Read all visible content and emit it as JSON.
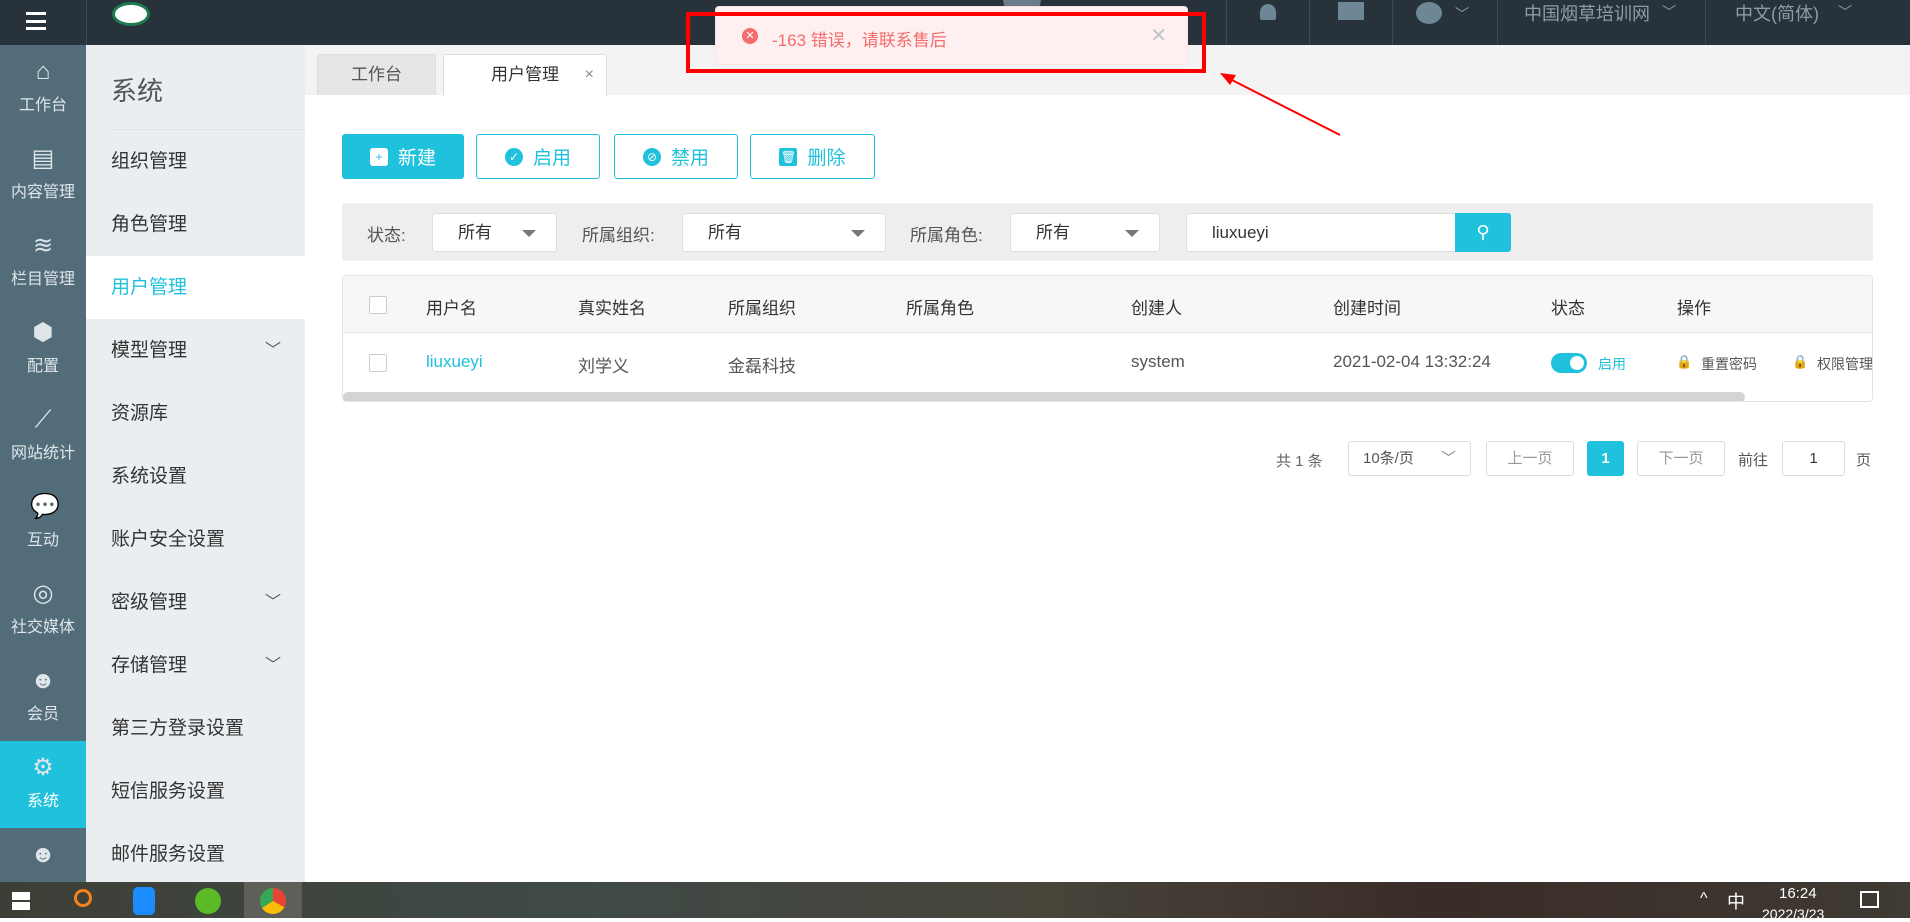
{
  "header": {
    "language": "中文(简体)",
    "site": "中国烟草培训网",
    "icons": [
      "menu-icon",
      "logo",
      "bell-icon",
      "monitor-icon",
      "palette-icon"
    ]
  },
  "toast": {
    "message": "-163 错误，请联系售后",
    "type": "error",
    "color": "#f56c6c"
  },
  "rail": [
    {
      "label": "工作台",
      "icon": "⌂"
    },
    {
      "label": "内容管理",
      "icon": "▤"
    },
    {
      "label": "栏目管理",
      "icon": "≋"
    },
    {
      "label": "配置",
      "icon": "⬢"
    },
    {
      "label": "网站统计",
      "icon": "⟋"
    },
    {
      "label": "互动",
      "icon": "💬"
    },
    {
      "label": "社交媒体",
      "icon": "◎"
    },
    {
      "label": "会员",
      "icon": "☻"
    },
    {
      "label": "系统",
      "icon": "⚙"
    },
    {
      "label": "",
      "icon": "☻"
    }
  ],
  "sub": {
    "title": "系统",
    "items": [
      {
        "label": "组织管理"
      },
      {
        "label": "角色管理"
      },
      {
        "label": "用户管理"
      },
      {
        "label": "模型管理",
        "chev": "﹀"
      },
      {
        "label": "资源库"
      },
      {
        "label": "系统设置"
      },
      {
        "label": "账户安全设置"
      },
      {
        "label": "密级管理",
        "chev": "﹀"
      },
      {
        "label": "存储管理",
        "chev": "﹀"
      },
      {
        "label": "第三方登录设置"
      },
      {
        "label": "短信服务设置"
      },
      {
        "label": "邮件服务设置"
      }
    ]
  },
  "tabs": [
    {
      "label": "工作台"
    },
    {
      "label": "用户管理",
      "close": "×"
    }
  ],
  "toolbar": {
    "new": "新建",
    "enable": "启用",
    "disable": "禁用",
    "delete": "删除"
  },
  "filter": {
    "status_label": "状态:",
    "status": "所有",
    "org_label": "所属组织:",
    "org": "所有",
    "role_label": "所属角色:",
    "role": "所有",
    "search": "liuxueyi"
  },
  "table": {
    "headers": [
      "用户名",
      "真实姓名",
      "所属组织",
      "所属角色",
      "创建人",
      "创建时间",
      "状态",
      "操作"
    ],
    "rows": [
      {
        "username": "liuxueyi",
        "realname": "刘学义",
        "org": "金磊科技",
        "role": "",
        "creator": "system",
        "created": "2021-02-04 13:32:24",
        "status": "启用",
        "enabled": true,
        "actions": [
          "重置密码",
          "权限管理"
        ]
      }
    ]
  },
  "pagination": {
    "total": "共 1 条",
    "page_size": "10条/页",
    "prev": "上一页",
    "current": "1",
    "next": "下一页",
    "goto": "前往",
    "goto_value": "1",
    "page_suffix": "页"
  },
  "taskbar": {
    "ime": "中",
    "time": "16:24",
    "date": "2022/3/23"
  },
  "colors": {
    "accent": "#20c1dc",
    "header": "#27323a",
    "rail": "#526c7a",
    "annotation": "#ff0000"
  }
}
